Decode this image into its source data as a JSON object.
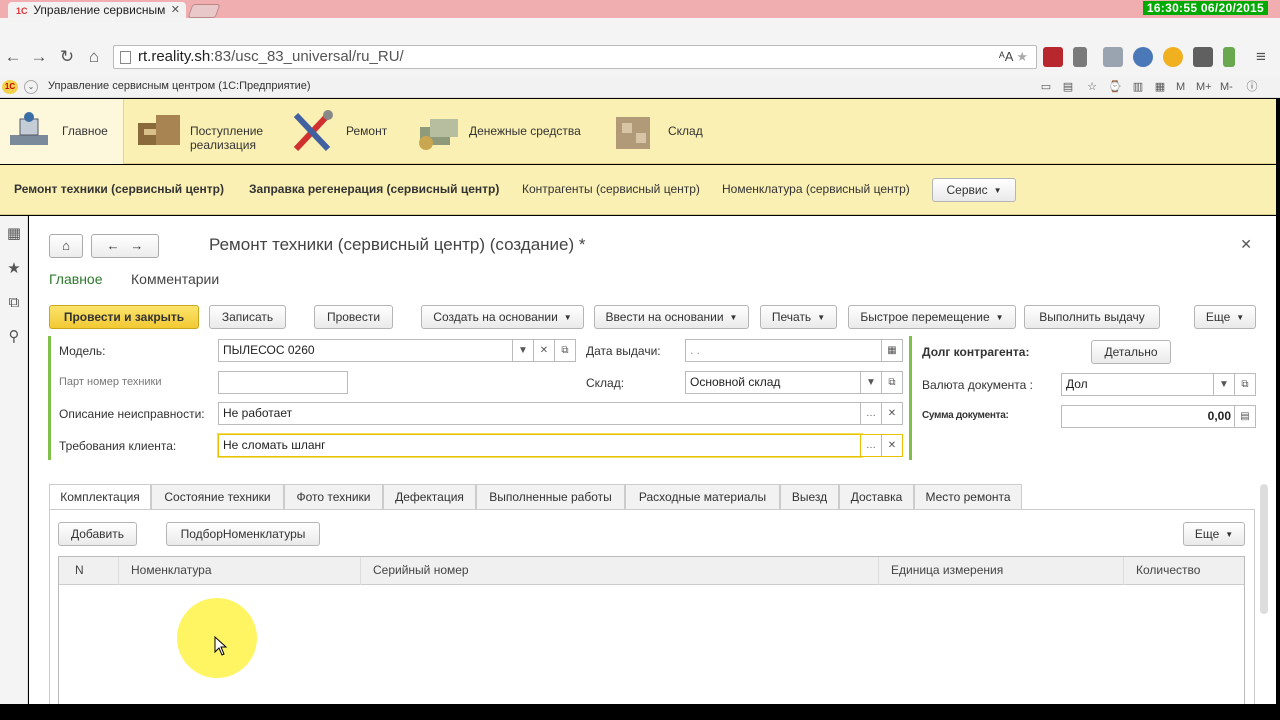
{
  "browser": {
    "tab_title": "Управление сервисным",
    "clock": "16:30:55 06/20/2015",
    "url_host": "rt.reality.sh",
    "url_rest": ":83/usc_83_universal/ru_RU/"
  },
  "app": {
    "title": "Управление сервисным центром  (1С:Предприятие)",
    "toolbar_labels": [
      "M",
      "M+",
      "M-"
    ]
  },
  "sections": [
    {
      "label": "Главное"
    },
    {
      "label_line1": "Поступление",
      "label_line2": "реализация"
    },
    {
      "label": "Ремонт"
    },
    {
      "label": "Денежные средства"
    },
    {
      "label": "Склад"
    }
  ],
  "subsections": [
    "Ремонт техники (сервисный центр)",
    "Заправка регенерация (сервисный центр)",
    "Контрагенты (сервисный центр)",
    "Номенклатура (сервисный центр)"
  ],
  "service_button": "Сервис",
  "form": {
    "title": "Ремонт техники (сервисный центр) (создание) *",
    "tabs": [
      "Главное",
      "Комментарии"
    ],
    "commands": {
      "post_close": "Провести и закрыть",
      "save": "Записать",
      "post": "Провести",
      "create_based": "Создать на основании",
      "enter_based": "Ввести на основании",
      "print": "Печать",
      "quick_move": "Быстрое перемещение",
      "issue": "Выполнить выдачу",
      "more": "Еще"
    },
    "fields": {
      "model_label": "Модель:",
      "model_value": "ПЫЛЕСОС 0260",
      "part_label": "Парт номер техники",
      "part_value": "",
      "fault_label": "Описание неисправности:",
      "fault_value": "Не  работает",
      "req_label": "Требования клиента:",
      "req_value": "Не сломать шланг",
      "issue_date_label": "Дата выдачи:",
      "issue_date_value": ". .",
      "warehouse_label": "Склад:",
      "warehouse_value": "Основной склад",
      "debt_label": "Долг контрагента:",
      "detail_button": "Детально",
      "currency_label": "Валюта документа :",
      "currency_value": "Дол",
      "sum_label": "Сумма документа:",
      "sum_value": "0,00"
    },
    "page_tabs": [
      "Комплектация",
      "Состояние техники",
      "Фото техники",
      "Дефектация",
      "Выполненные работы",
      "Расходные материалы",
      "Выезд",
      "Доставка",
      "Место ремонта"
    ],
    "table_buttons": {
      "add": "Добавить",
      "pick": "ПодборНоменклатуры",
      "more": "Еще"
    },
    "columns": [
      "N",
      "Номенклатура",
      "Серийный номер",
      "Единица измерения",
      "Количество"
    ]
  }
}
